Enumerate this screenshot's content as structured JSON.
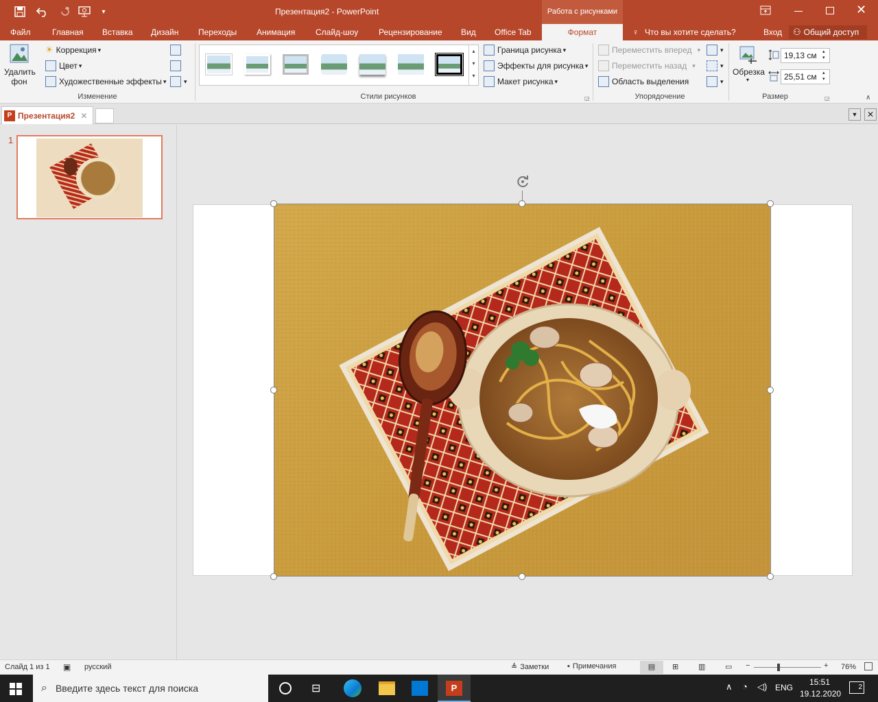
{
  "colors": {
    "accent": "#b7472a",
    "ribbon_bg": "#f3f3f3",
    "taskbar": "#1f1f1f"
  },
  "titlebar": {
    "title": "Презентация2 - PowerPoint",
    "context_group": "Работа с рисунками",
    "icons": [
      "save-icon",
      "undo-icon",
      "redo-icon",
      "start-slideshow-icon",
      "customize-qat-icon"
    ]
  },
  "tabs": [
    "Файл",
    "Главная",
    "Вставка",
    "Дизайн",
    "Переходы",
    "Анимация",
    "Слайд-шоу",
    "Рецензирование",
    "Вид",
    "Office Tab",
    "Формат"
  ],
  "active_tab": "Формат",
  "tell_me": "Что вы хотите сделать?",
  "signin": "Вход",
  "share": "Общий доступ",
  "ribbon": {
    "remove_bg": "Удалить фон",
    "correction": "Коррекция",
    "color": "Цвет",
    "artistic": "Художественные эффекты",
    "group_adjust": "Изменение",
    "group_styles": "Стили рисунков",
    "border": "Граница рисунка",
    "effects": "Эффекты для рисунка",
    "layout": "Макет рисунка",
    "bring_forward": "Переместить вперед",
    "send_backward": "Переместить назад",
    "selection_pane": "Область выделения",
    "group_arrange": "Упорядочение",
    "crop": "Обрезка",
    "height": "19,13 см",
    "width": "25,51 см",
    "group_size": "Размер"
  },
  "doc_tab": "Презентация2",
  "slide_number": "1",
  "status": {
    "slide": "Слайд 1 из 1",
    "language": "русский",
    "notes": "Заметки",
    "comments": "Примечания",
    "zoom": "76%"
  },
  "taskbar": {
    "search_placeholder": "Введите здесь текст для поиска",
    "lang": "ENG",
    "time": "15:51",
    "date": "19.12.2020",
    "notifications": "2"
  }
}
